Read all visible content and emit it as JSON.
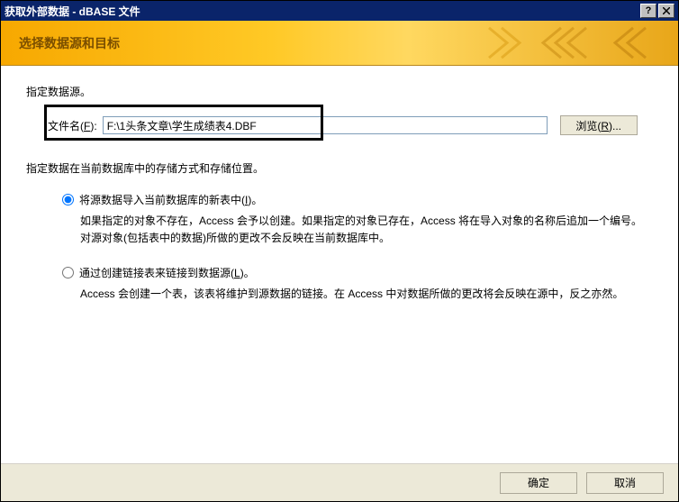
{
  "window": {
    "title": "获取外部数据 - dBASE 文件"
  },
  "header": {
    "title": "选择数据源和目标"
  },
  "source": {
    "label": "指定数据源。",
    "filename_label_prefix": "文件名(",
    "filename_hotkey": "F",
    "filename_label_suffix": "):",
    "filename_value": "F:\\1头条文章\\学生成绩表4.DBF",
    "browse_prefix": "浏览(",
    "browse_hotkey": "R",
    "browse_suffix": ")..."
  },
  "storage": {
    "label": "指定数据在当前数据库中的存储方式和存储位置。",
    "options": [
      {
        "label_prefix": "将源数据导入当前数据库的新表中(",
        "hotkey": "I",
        "label_suffix": ")。",
        "desc": "如果指定的对象不存在，Access 会予以创建。如果指定的对象已存在，Access 将在导入对象的名称后追加一个编号。对源对象(包括表中的数据)所做的更改不会反映在当前数据库中。"
      },
      {
        "label_prefix": "通过创建链接表来链接到数据源(",
        "hotkey": "L",
        "label_suffix": ")。",
        "desc": "Access 会创建一个表，该表将维护到源数据的链接。在 Access 中对数据所做的更改将会反映在源中，反之亦然。"
      }
    ]
  },
  "footer": {
    "ok": "确定",
    "cancel": "取消"
  }
}
